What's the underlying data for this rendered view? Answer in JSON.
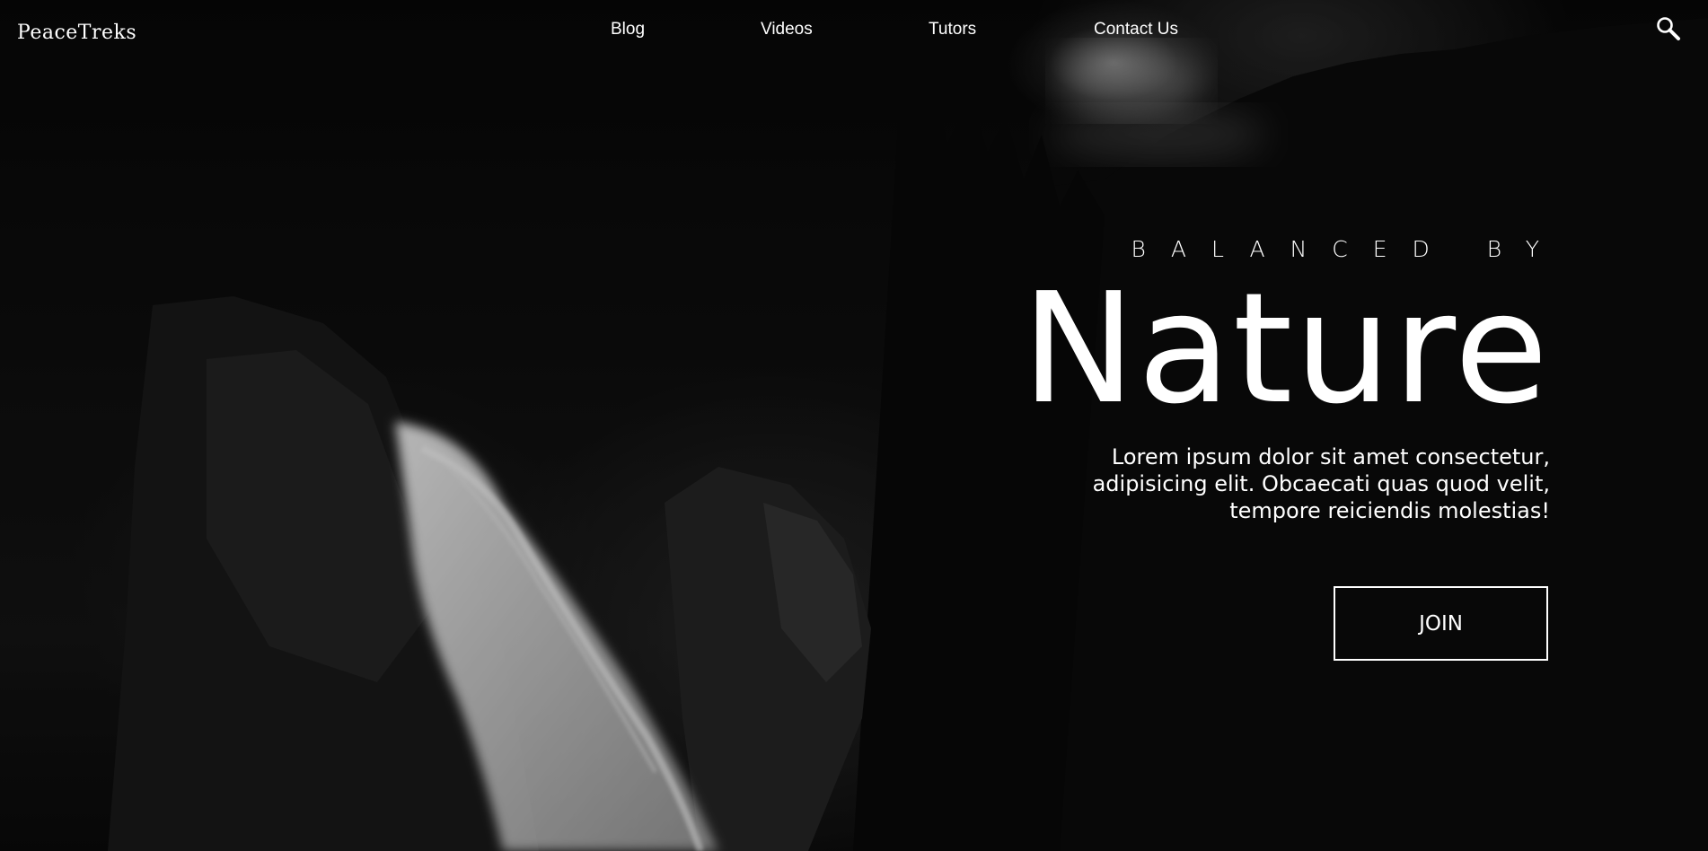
{
  "brand": {
    "logo": "PeaceTreks"
  },
  "nav": {
    "items": [
      {
        "label": "Blog"
      },
      {
        "label": "Videos"
      },
      {
        "label": "Tutors"
      },
      {
        "label": "Contact Us"
      }
    ],
    "search_icon": "search-icon"
  },
  "hero": {
    "tagline": "BALANCED BY",
    "headline": "Nature",
    "blurb": "Lorem ipsum dolor sit amet consectetur, adipisicing elit. Obcaecati quas quod velit, tempore reiciendis molestias!",
    "cta_label": "JOIN"
  },
  "colors": {
    "text": "#ffffff",
    "background": "#000000"
  }
}
